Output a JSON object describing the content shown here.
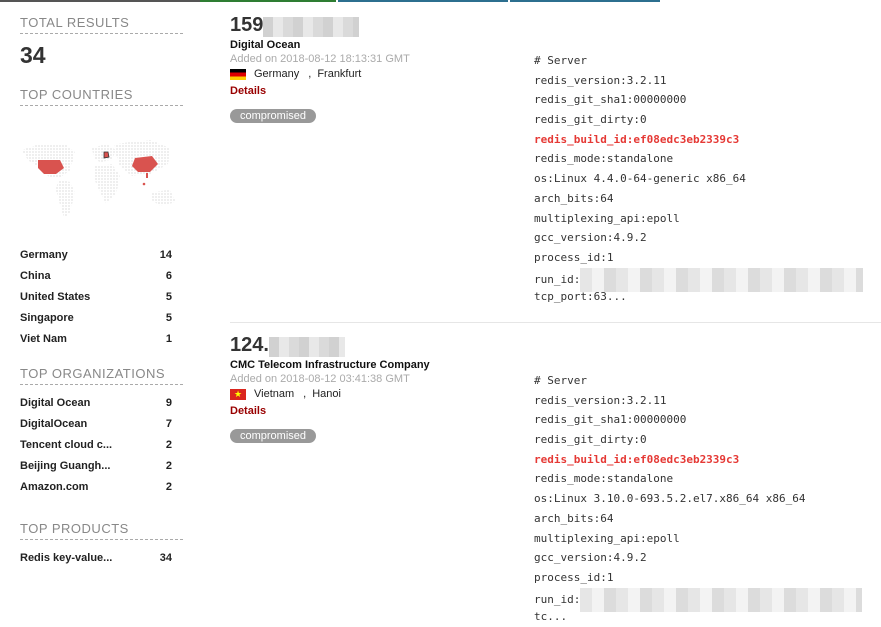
{
  "colors": {
    "accent_red": "#990000",
    "highlight_red": "#e53935",
    "tag_gray": "#999999"
  },
  "sidebar": {
    "total_results_title": "TOTAL RESULTS",
    "total_results_value": "34",
    "top_countries_title": "TOP COUNTRIES",
    "countries": [
      {
        "name": "Germany",
        "count": "14"
      },
      {
        "name": "China",
        "count": "6"
      },
      {
        "name": "United States",
        "count": "5"
      },
      {
        "name": "Singapore",
        "count": "5"
      },
      {
        "name": "Viet Nam",
        "count": "1"
      }
    ],
    "top_organizations_title": "TOP ORGANIZATIONS",
    "organizations": [
      {
        "name": "Digital Ocean",
        "count": "9"
      },
      {
        "name": "DigitalOcean",
        "count": "7"
      },
      {
        "name": "Tencent cloud c...",
        "count": "2"
      },
      {
        "name": "Beijing Guangh...",
        "count": "2"
      },
      {
        "name": "Amazon.com",
        "count": "2"
      }
    ],
    "top_products_title": "TOP PRODUCTS",
    "products": [
      {
        "name": "Redis key-value...",
        "count": "34"
      }
    ]
  },
  "results": [
    {
      "ip_prefix": "159",
      "org": "Digital Ocean",
      "added": "Added on 2018-08-12 18:13:31 GMT",
      "country": "Germany",
      "city": "Frankfurt",
      "flag_icon": "germany-flag-icon",
      "details_label": "Details",
      "tag": "compromised",
      "banner": {
        "l0": "# Server",
        "l1": "redis_version:3.2.11",
        "l2": "redis_git_sha1:00000000",
        "l3": "redis_git_dirty:0",
        "l4": "redis_build_id:ef08edc3eb2339c3",
        "l5": "redis_mode:standalone",
        "l6": "os:Linux 4.4.0-64-generic x86_64",
        "l7": "arch_bits:64",
        "l8": "multiplexing_api:epoll",
        "l9": "gcc_version:4.9.2",
        "l10": "process_id:1",
        "l11": "run_id:",
        "l12": "tcp_port:63..."
      }
    },
    {
      "ip_prefix": "124.",
      "org": "CMC Telecom Infrastructure Company",
      "added": "Added on 2018-08-12 03:41:38 GMT",
      "country": "Vietnam",
      "city": "Hanoi",
      "flag_icon": "vietnam-flag-icon",
      "details_label": "Details",
      "tag": "compromised",
      "banner": {
        "l0": "# Server",
        "l1": "redis_version:3.2.11",
        "l2": "redis_git_sha1:00000000",
        "l3": "redis_git_dirty:0",
        "l4": "redis_build_id:ef08edc3eb2339c3",
        "l5": "redis_mode:standalone",
        "l6": "os:Linux 3.10.0-693.5.2.el7.x86_64 x86_64",
        "l7": "arch_bits:64",
        "l8": "multiplexing_api:epoll",
        "l9": "gcc_version:4.9.2",
        "l10": "process_id:1",
        "l11": "run_id:",
        "l12": "tc..."
      }
    }
  ]
}
